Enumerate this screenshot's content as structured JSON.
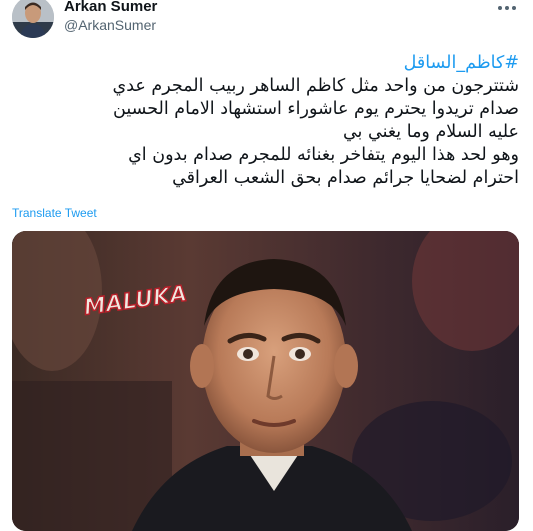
{
  "author": {
    "display_name": "Arkan Sumer",
    "handle": "@ArkanSumer",
    "avatar_icon": "user-avatar-photo"
  },
  "more_icon": "more-options-icon",
  "tweet": {
    "hashtag": "#كاظم_الساقل",
    "lines": [
      "شتترجون من واحد مثل كاظم الساهر ربيب المجرم عدي",
      "صدام تريدوا يحترم يوم عاشوراء استشهاد الامام الحسين",
      "عليه السلام وما يغني بي",
      "وهو لحد هذا اليوم يتفاخر بغنائه للمجرم صدام بدون اي",
      "احترام لضحايا جرائم صدام بحق الشعب العراقي"
    ]
  },
  "translate_label": "Translate Tweet",
  "media": {
    "watermark": "MALUKA",
    "description_icon": "tv-interview-photo"
  },
  "colors": {
    "link": "#1d9bf0",
    "text": "#0f1419",
    "muted": "#536471"
  }
}
